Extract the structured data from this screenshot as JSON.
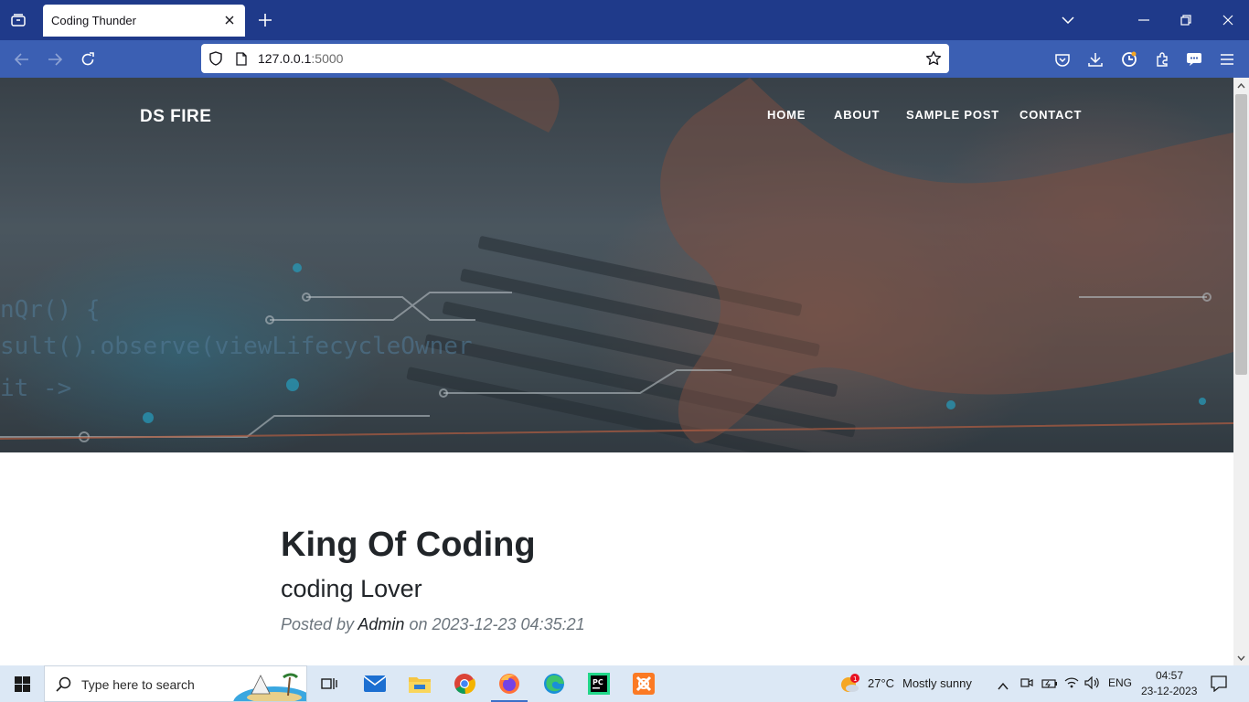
{
  "browser": {
    "tab_title": "Coding Thunder",
    "url_host": "127.0.0.1",
    "url_port": ":5000"
  },
  "site": {
    "brand": "DS FIRE",
    "nav": [
      "HOME",
      "ABOUT",
      "SAMPLE POST",
      "CONTACT"
    ]
  },
  "post": {
    "title": "King Of Coding",
    "subtitle": "coding Lover",
    "meta_prefix": "Posted by",
    "author": "Admin",
    "meta_on": "on 2023-12-23 04:35:21"
  },
  "taskbar": {
    "search_placeholder": "Type here to search",
    "weather_temp": "27°C",
    "weather_desc": "Mostly sunny",
    "weather_badge": "1",
    "language": "ENG",
    "time": "04:57",
    "date": "23-12-2023"
  },
  "colors": {
    "browser_titlebar": "#1f3a8a",
    "browser_navbar": "#3b5fb3",
    "heading_text": "#212529",
    "meta_text": "#6c757d"
  }
}
